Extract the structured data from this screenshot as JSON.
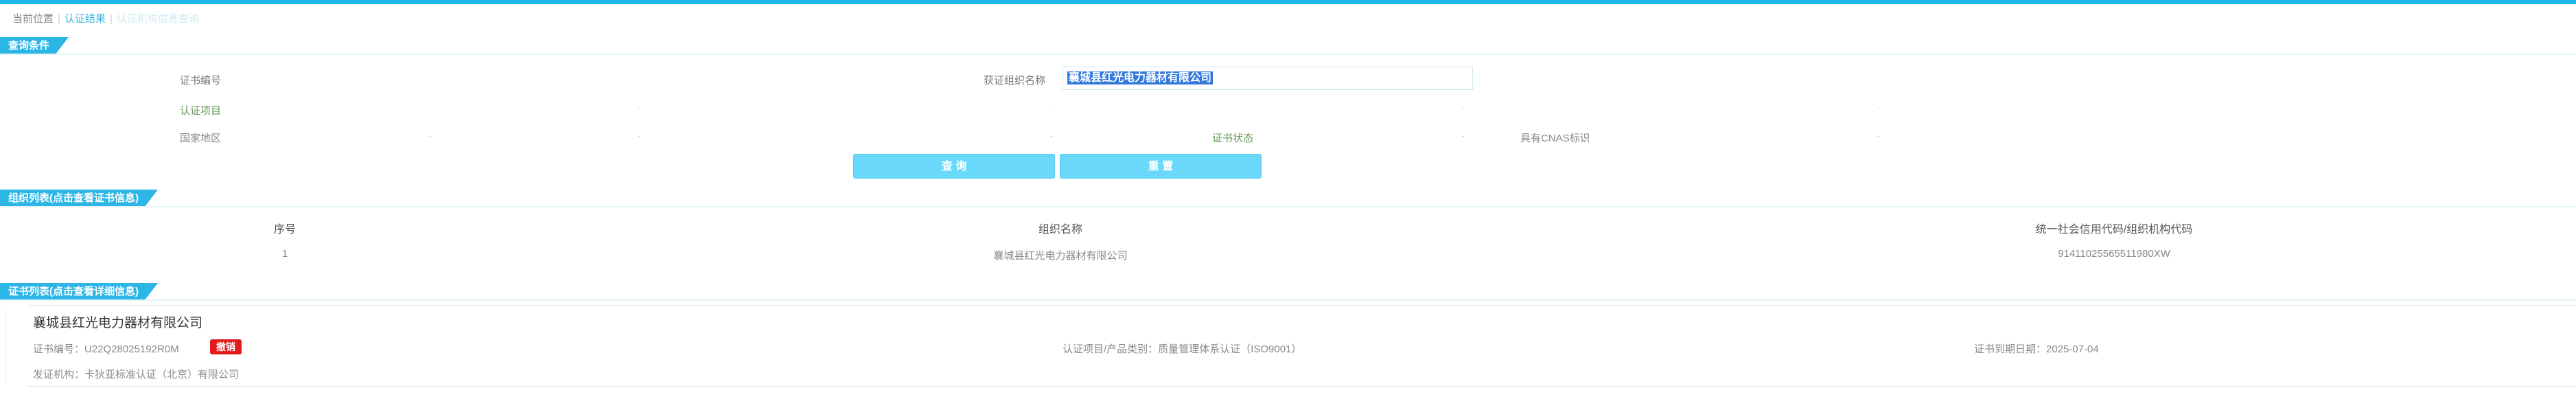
{
  "breadcrumb": {
    "current_label": "当前位置",
    "level1": "认证结果",
    "level2": "认证机构信息查询"
  },
  "query_section": {
    "title": "查询条件",
    "fields": {
      "cert_no_label": "证书编号",
      "org_name_label": "获证组织名称",
      "org_name_value": "襄城县红光电力器材有限公司",
      "cert_item_label": "认证项目",
      "region_label": "国家地区",
      "status_label": "证书状态",
      "cnas_label": "具有CNAS标识"
    },
    "buttons": {
      "search": "查 询",
      "reset": "重 置"
    }
  },
  "org_list": {
    "title": "组织列表(点击查看证书信息)",
    "columns": [
      "序号",
      "组织名称",
      "统一社会信用代码/组织机构代码"
    ],
    "rows": [
      [
        "1",
        "襄城县红光电力器材有限公司",
        "91411025565511980XW"
      ]
    ]
  },
  "cert_list": {
    "title": "证书列表(点击查看详细信息)",
    "items": [
      {
        "org_name": "襄城县红光电力器材有限公司",
        "cert_no_label": "证书编号：",
        "cert_no": "U22Q28025192R0M",
        "status": "撤销",
        "item_label": "认证项目/产品类别：",
        "item_value": "质量管理体系认证（ISO9001）",
        "expiry_label": "证书到期日期：",
        "expiry_value": "2025-07-04",
        "issuer_label": "发证机构：",
        "issuer_value": "卡狄亚标准认证（北京）有限公司"
      }
    ]
  },
  "colors": {
    "accent": "#1cb7e6",
    "button": "#69d8fb",
    "revoked_badge": "#e11b1b",
    "selection": "#3379d9"
  }
}
